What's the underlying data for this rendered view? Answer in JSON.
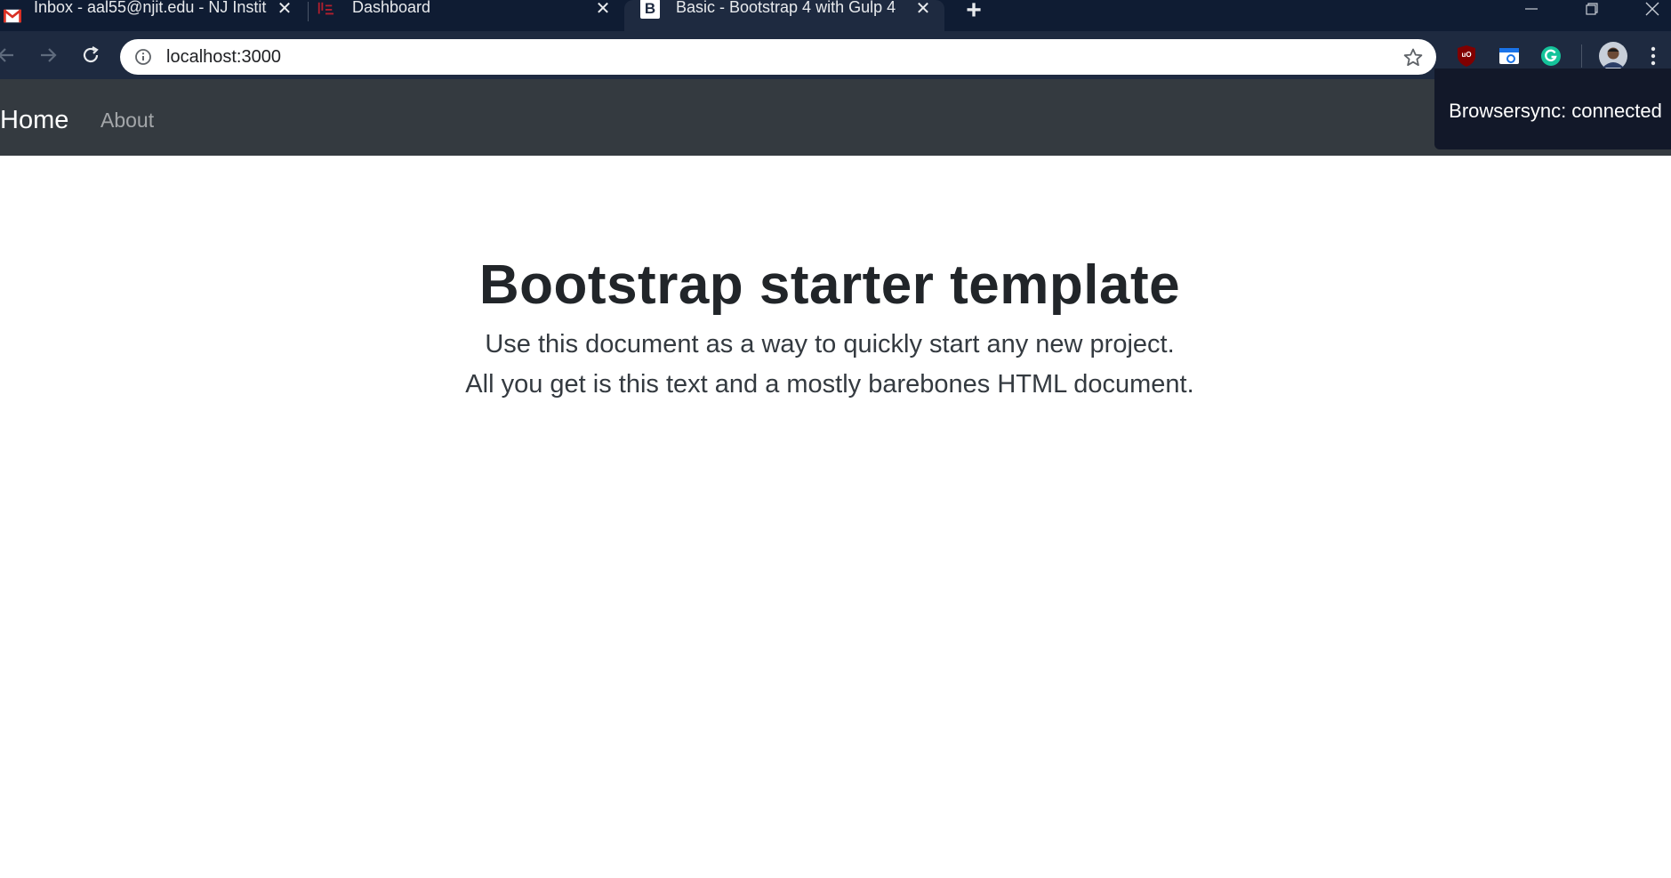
{
  "browser": {
    "tabs": [
      {
        "title": "Inbox - aal55@njit.edu - NJ Instit",
        "favicon": "gmail-icon",
        "active": false
      },
      {
        "title": "Dashboard",
        "favicon": "njit-logo-icon",
        "active": false
      },
      {
        "title": "Basic - Bootstrap 4 with Gulp 4",
        "favicon": "bootstrap-icon",
        "favicon_text": "B",
        "active": true
      }
    ],
    "tab_close_glyph": "✕",
    "new_tab_glyph": "+",
    "address": {
      "url": "localhost:3000"
    },
    "extensions": [
      "ublock-icon",
      "screenshot-extension-icon",
      "grammarly-icon"
    ],
    "colors": {
      "tabstrip": "#0f1c33",
      "toolbar": "#1e2a40",
      "ublock": "#800000",
      "grammarly": "#15c39a"
    }
  },
  "page": {
    "navbar": {
      "brand": "Home",
      "links": [
        "About"
      ],
      "background": "#343a40"
    },
    "browsersync": {
      "message": "Browsersync: connected"
    },
    "jumbotron": {
      "title": "Bootstrap starter template",
      "lead_line1": "Use this document as a way to quickly start any new project.",
      "lead_line2": "All you get is this text and a mostly barebones HTML document."
    }
  }
}
